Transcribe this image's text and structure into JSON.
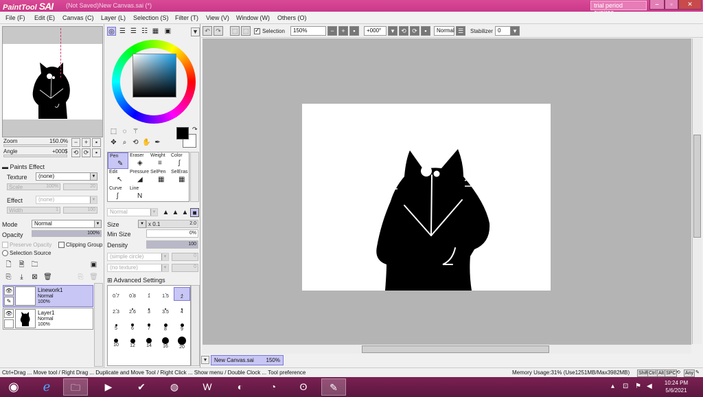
{
  "titlebar": {
    "app_name": "PaintTool",
    "app_name_big": "SAI",
    "doc_title": "(Not Saved)New Canvas.sai (*)",
    "trial_label": "trial period expires"
  },
  "menu": [
    {
      "label": "File (F)"
    },
    {
      "label": "Edit (E)"
    },
    {
      "label": "Canvas (C)"
    },
    {
      "label": "Layer (L)"
    },
    {
      "label": "Selection (S)"
    },
    {
      "label": "Filter (T)"
    },
    {
      "label": "View (V)"
    },
    {
      "label": "Window (W)"
    },
    {
      "label": "Others (O)"
    }
  ],
  "navigator": {
    "zoom_label": "Zoom",
    "zoom_value": "150.0%",
    "angle_label": "Angle",
    "angle_value": "+000$"
  },
  "paints_effect": {
    "header": "Paints Effect",
    "texture_label": "Texture",
    "texture_value": "(none)",
    "scale_label": "Scale",
    "scale_value": "100%",
    "scale_num": "20",
    "effect_label": "Effect",
    "effect_value": "(none)",
    "width_label": "Width",
    "width_value": "1",
    "width_num": "100"
  },
  "layer_props": {
    "mode_label": "Mode",
    "mode_value": "Normal",
    "opacity_label": "Opacity",
    "opacity_value": "100%",
    "opacity_pct": 100,
    "preserve_opacity": "Preserve Opacity",
    "clipping_group": "Clipping Group",
    "selection_source": "Selection Source"
  },
  "layers": [
    {
      "name": "Linework1",
      "mode": "Normal",
      "opacity": "100%",
      "selected": true
    },
    {
      "name": "Layer1",
      "mode": "Normal",
      "opacity": "100%",
      "selected": false
    }
  ],
  "brushes": [
    {
      "name": "Pen",
      "icon": "✎",
      "selected": true
    },
    {
      "name": "Eraser",
      "icon": "◈"
    },
    {
      "name": "Weight",
      "icon": "≡"
    },
    {
      "name": "Color",
      "icon": "ʃ"
    },
    {
      "name": "Edit",
      "icon": "↖"
    },
    {
      "name": "Pressure",
      "icon": "◢"
    },
    {
      "name": "SelPen",
      "icon": "▦"
    },
    {
      "name": "SelEras",
      "icon": "▦"
    },
    {
      "name": "Curve",
      "icon": "ʃ"
    },
    {
      "name": "Line",
      "icon": "N"
    }
  ],
  "tool_settings": {
    "blend_mode": "Normal",
    "size_label": "Size",
    "size_mult": "x 0.1",
    "size_value": "2.0",
    "min_size_label": "Min Size",
    "min_size_value": "0%",
    "density_label": "Density",
    "density_value": "100",
    "shape": "(simple circle)",
    "shape_num": "0",
    "texture": "(no texture)",
    "texture_num": "0",
    "advanced": "Advanced Settings"
  },
  "brush_sizes": [
    "0.7",
    "0.8",
    "1",
    "1.5",
    "2",
    "2.3",
    "2.6",
    "3",
    "3.5",
    "4",
    "5",
    "6",
    "7",
    "8",
    "9",
    "10",
    "12",
    "14",
    "16",
    "20"
  ],
  "toolbar": {
    "selection_label": "Selection",
    "zoom_value": "150%",
    "angle_value": "+000°",
    "mode_value": "Normal",
    "stabilizer_label": "Stabilizer",
    "stabilizer_value": "0"
  },
  "document_tab": {
    "name": "New Canvas.sai",
    "zoom": "150%"
  },
  "status": {
    "hint": "Ctrl+Drag ... Move tool / Right Drag ... Duplicate and Move Tool / Right Click ... Show menu / Double Clock ... Tool preference",
    "memory": "Memory Usage:31% (Use1251MB/Max3982MB)",
    "keys": [
      "Shift",
      "Ctrl",
      "Alt",
      "SPC",
      "Any"
    ]
  },
  "clock": {
    "time": "10:24 PM",
    "date": "5/6/2021"
  },
  "colors": {
    "title_bar": "#c9388a",
    "taskbar": "#6b1b48",
    "selection": "#c8c6f4",
    "canvas_bg": "#b4b4b4"
  }
}
